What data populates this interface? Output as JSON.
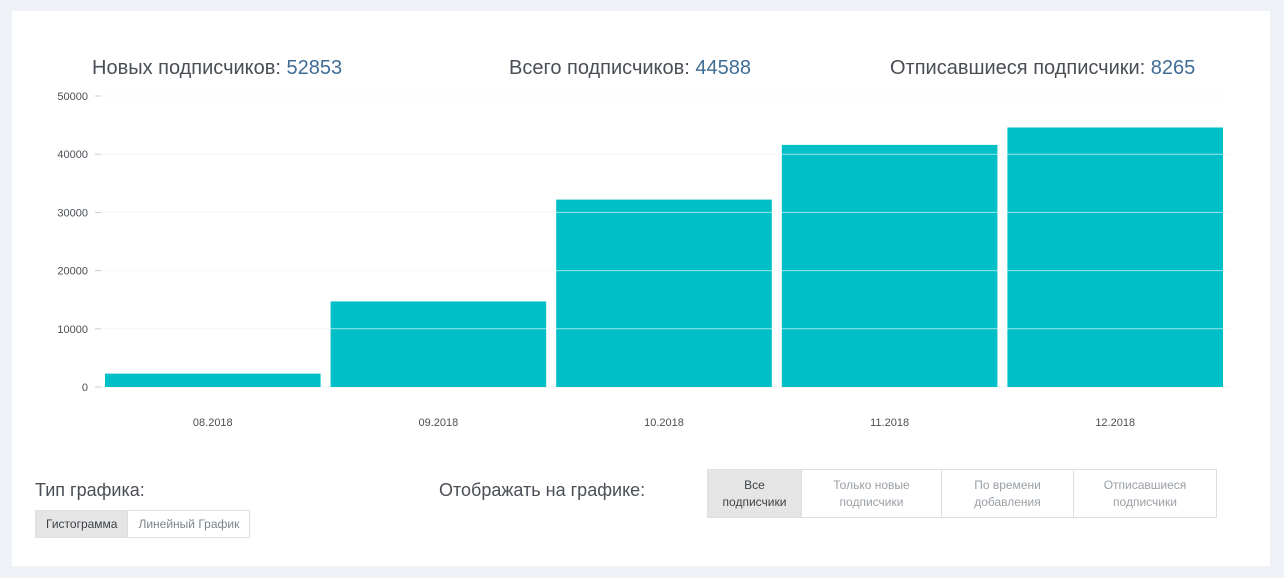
{
  "stats": {
    "new_label": "Новых подписчиков:",
    "new_value": "52853",
    "total_label": "Всего подписчиков:",
    "total_value": "44588",
    "unsub_label": "Отписавшиеся подписчики:",
    "unsub_value": "8265"
  },
  "chart_data": {
    "type": "bar",
    "categories": [
      "08.2018",
      "09.2018",
      "10.2018",
      "11.2018",
      "12.2018"
    ],
    "values": [
      2300,
      14700,
      32200,
      41600,
      44588
    ],
    "ylim": [
      0,
      50000
    ],
    "yticks": [
      0,
      10000,
      20000,
      30000,
      40000,
      50000
    ],
    "grid": true,
    "color": "#00bfc7"
  },
  "controls": {
    "chart_type_label": "Тип графика:",
    "chart_types": [
      {
        "label": "Гистограмма",
        "active": true
      },
      {
        "label": "Линейный График",
        "active": false
      }
    ],
    "display_label": "Отображать на графике:",
    "display_options": [
      {
        "line1": "Все",
        "line2": "подписчики",
        "active": true
      },
      {
        "line1": "Только новые",
        "line2": "подписчики",
        "active": false
      },
      {
        "line1": "По времени",
        "line2": "добавления",
        "active": false
      },
      {
        "line1": "Отписавшиеся",
        "line2": "подписчики",
        "active": false
      }
    ]
  }
}
